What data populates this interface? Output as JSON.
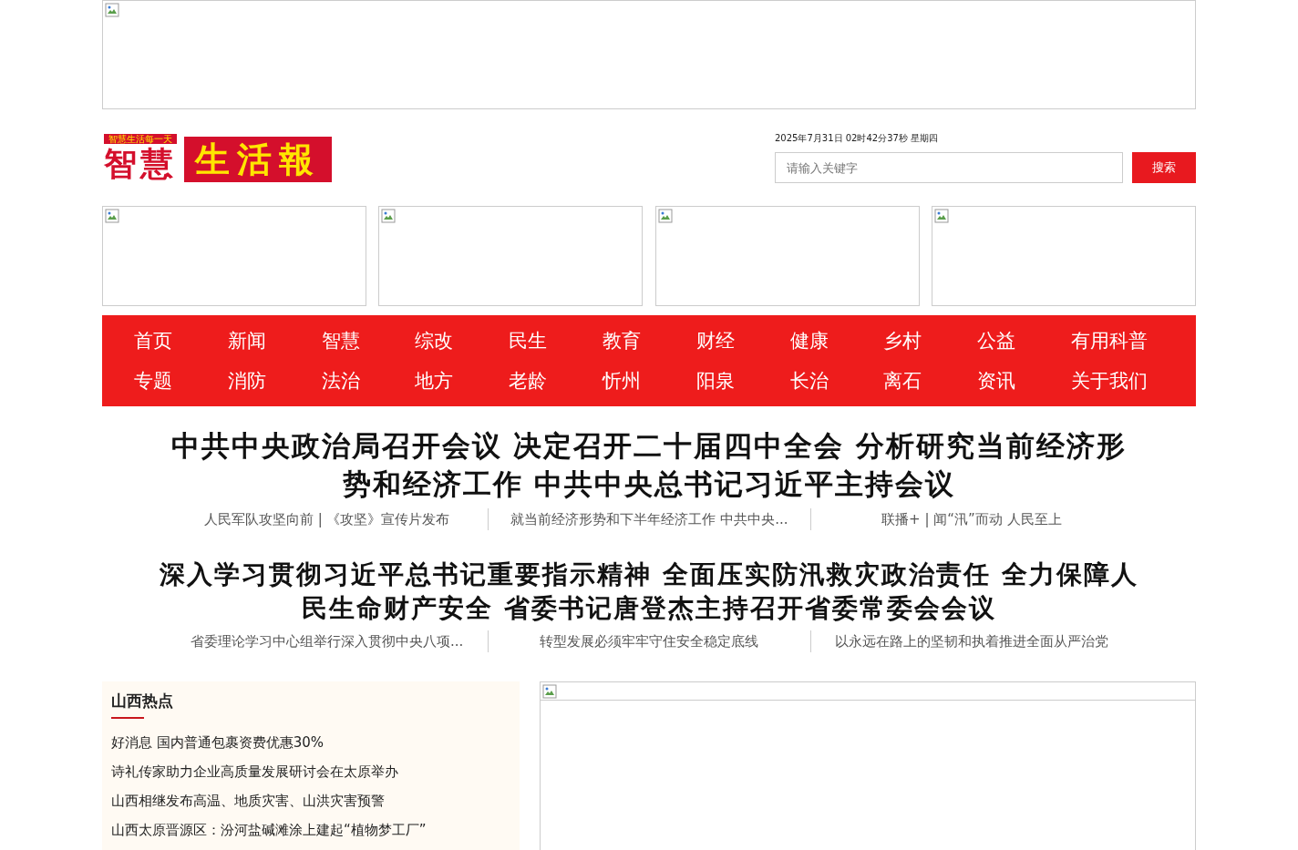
{
  "logo": {
    "tagline": "智慧生活每一天",
    "brand": "智慧",
    "name": "生活報"
  },
  "date": "2025年7月31日 02时42分37秒 星期四",
  "search": {
    "placeholder": "请输入关键字",
    "button": "搜索"
  },
  "nav": [
    [
      "首页",
      "新闻",
      "智慧",
      "综改",
      "民生",
      "教育",
      "财经",
      "健康",
      "乡村",
      "公益",
      "有用科普"
    ],
    [
      "专题",
      "消防",
      "法治",
      "地方",
      "老龄",
      "忻州",
      "阳泉",
      "长治",
      "离石",
      "资讯",
      "关于我们"
    ]
  ],
  "headlines": [
    {
      "title": "中共中央政治局召开会议 决定召开二十届四中全会 分析研究当前经济形势和经济工作 中共中央总书记习近平主持会议",
      "links": [
        "人民军队攻坚向前 | 《攻坚》宣传片发布",
        "就当前经济形势和下半年经济工作 中共中央...",
        "联播+ | 闻“汛”而动 人民至上"
      ]
    },
    {
      "title": "深入学习贯彻习近平总书记重要指示精神 全面压实防汛救灾政治责任 全力保障人民生命财产安全 省委书记唐登杰主持召开省委常委会会议",
      "links": [
        "省委理论学习中心组举行深入贯彻中央八项...",
        "转型发展必须牢牢守住安全稳定底线",
        "以永远在路上的坚韧和执着推进全面从严治党"
      ]
    }
  ],
  "hot": {
    "title": "山西热点",
    "items": [
      "好消息 国内普通包裹资费优惠30%",
      "诗礼传家助力企业高质量发展研讨会在太原举办",
      "山西相继发布高温、地质灾害、山洪灾害预警",
      "山西太原晋源区：汾河盐碱滩涂上建起“植物梦工厂”"
    ]
  }
}
